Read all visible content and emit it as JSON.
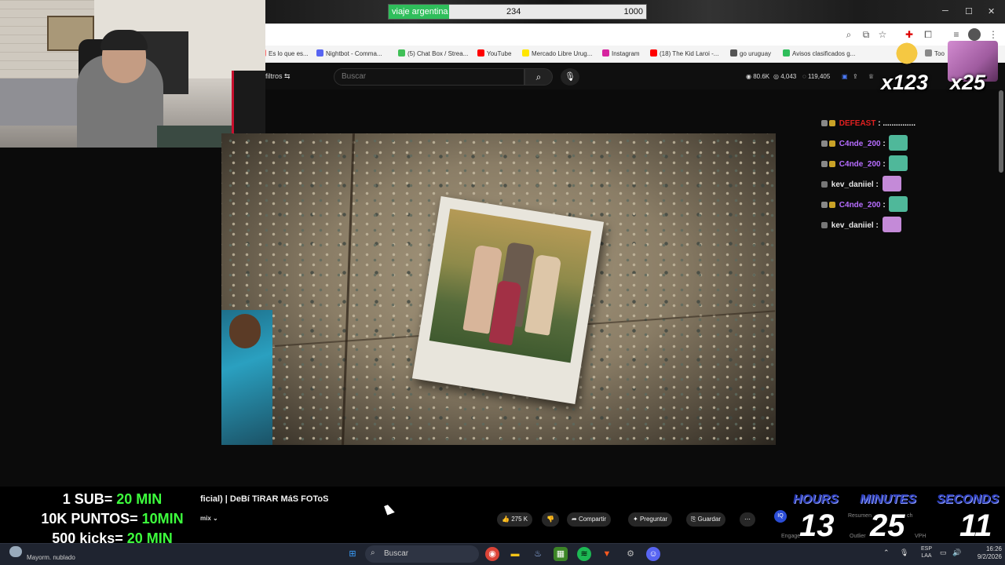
{
  "goal": {
    "title": "viaje argentina",
    "current": "234",
    "max": "1000",
    "progress": 0.234,
    "fill_color": "#2fbe5b"
  },
  "window_controls": {
    "minimize": "─",
    "maximize": "☐",
    "close": "✕"
  },
  "bookmarks": [
    {
      "label": "Es lo que es...",
      "color": "#ff6b6b"
    },
    {
      "label": "Nightbot - Comma...",
      "color": "#5865f2"
    },
    {
      "label": "(5) Chat Box / Strea...",
      "color": "#40c057"
    },
    {
      "label": "YouTube",
      "color": "#ff0000"
    },
    {
      "label": "Mercado Libre Urug...",
      "color": "#ffe600"
    },
    {
      "label": "Instagram",
      "color": "#d6249f"
    },
    {
      "label": "(18) The Kid Laroi -...",
      "color": "#ff0000"
    },
    {
      "label": "go uruguay",
      "color": "#555555"
    },
    {
      "label": "Avisos clasificados g...",
      "color": "#2fbe5b"
    },
    {
      "label": "Too",
      "color": "#888888"
    }
  ],
  "youtube": {
    "filters_label": "filtros",
    "search_placeholder": "Buscar",
    "stats": {
      "views": "80.6K",
      "likes": "4,043",
      "extra": "119,405"
    }
  },
  "overlay": {
    "subs_counter_1": "x123",
    "subs_counter_2": "x25"
  },
  "chat": [
    {
      "name": "DEFEAST",
      "color": "#e02020",
      "text": "...............",
      "emote": null
    },
    {
      "name": "C4nde_200",
      "color": "#b66dff",
      "text": "",
      "emote": "#4fb89a"
    },
    {
      "name": "C4nde_200",
      "color": "#b66dff",
      "text": "",
      "emote": "#4fb89a"
    },
    {
      "name": "kev_daniiel",
      "color": "#e6e6e6",
      "text": "",
      "emote": "#c48ad8"
    },
    {
      "name": "C4nde_200",
      "color": "#b66dff",
      "text": "",
      "emote": "#4fb89a"
    },
    {
      "name": "kev_daniiel",
      "color": "#e6e6e6",
      "text": "",
      "emote": "#c48ad8"
    }
  ],
  "video": {
    "title": "ficial) | DeBí TiRAR MáS FOToS",
    "remix_chip": "mix",
    "actions": {
      "likes": "275 K",
      "share": "Compartir",
      "ask": "Preguntar",
      "save": "Guardar",
      "more": "⋯"
    }
  },
  "rules": [
    {
      "prefix": "1 SUB= ",
      "value": "20 MIN"
    },
    {
      "prefix": "10K PUNTOS= ",
      "value": "10MIN"
    },
    {
      "prefix": "500 kicks= ",
      "value": "20 MIN"
    }
  ],
  "timer": {
    "hours_label": "HOURS",
    "minutes_label": "MINUTES",
    "seconds_label": "SECONDS",
    "hours": "13",
    "minutes": "25",
    "seconds": "11",
    "extra": {
      "resumen": "Resumen",
      "engage": "Engage",
      "outlier": "Outlier",
      "vph": "VPH",
      "ch": "ch"
    }
  },
  "taskbar": {
    "weather": "Mayorm. nublado",
    "search": "Buscar",
    "lang_top": "ESP",
    "lang_bottom": "LAA",
    "time": "16:26",
    "date": "9/2/2026"
  }
}
